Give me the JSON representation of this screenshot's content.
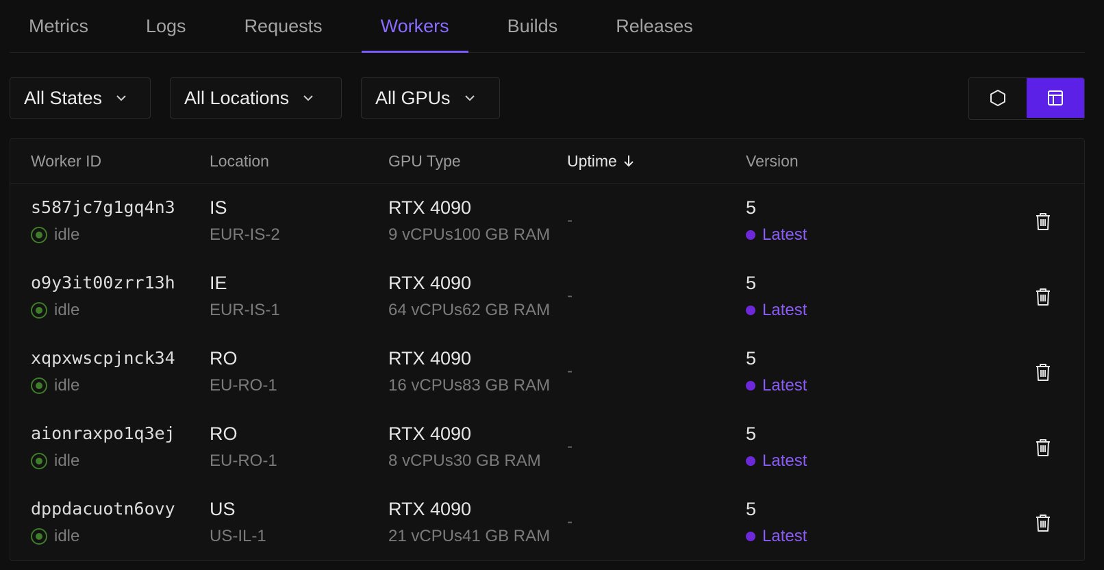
{
  "tabs": [
    {
      "label": "Metrics",
      "active": false
    },
    {
      "label": "Logs",
      "active": false
    },
    {
      "label": "Requests",
      "active": false
    },
    {
      "label": "Workers",
      "active": true
    },
    {
      "label": "Builds",
      "active": false
    },
    {
      "label": "Releases",
      "active": false
    }
  ],
  "filters": {
    "state": "All States",
    "location": "All Locations",
    "gpu": "All GPUs"
  },
  "view_toggle": {
    "grid_icon": "hexagon-icon",
    "table_icon": "table-layout-icon",
    "active": "table"
  },
  "table": {
    "headers": {
      "worker_id": "Worker ID",
      "location": "Location",
      "gpu_type": "GPU Type",
      "uptime": "Uptime",
      "version": "Version"
    },
    "rows": [
      {
        "id": "s587jc7g1gq4n3",
        "status": "idle",
        "loc": "IS",
        "region": "EUR-IS-2",
        "gpu": "RTX 4090",
        "spec": "9 vCPUs100 GB RAM",
        "uptime": "-",
        "version": "5",
        "version_tag": "Latest"
      },
      {
        "id": "o9y3it00zrr13h",
        "status": "idle",
        "loc": "IE",
        "region": "EUR-IS-1",
        "gpu": "RTX 4090",
        "spec": "64 vCPUs62 GB RAM",
        "uptime": "-",
        "version": "5",
        "version_tag": "Latest"
      },
      {
        "id": "xqpxwscpjnck34",
        "status": "idle",
        "loc": "RO",
        "region": "EU-RO-1",
        "gpu": "RTX 4090",
        "spec": "16 vCPUs83 GB RAM",
        "uptime": "-",
        "version": "5",
        "version_tag": "Latest"
      },
      {
        "id": "aionraxpo1q3ej",
        "status": "idle",
        "loc": "RO",
        "region": "EU-RO-1",
        "gpu": "RTX 4090",
        "spec": "8 vCPUs30 GB RAM",
        "uptime": "-",
        "version": "5",
        "version_tag": "Latest"
      },
      {
        "id": "dppdacuotn6ovy",
        "status": "idle",
        "loc": "US",
        "region": "US-IL-1",
        "gpu": "RTX 4090",
        "spec": "21 vCPUs41 GB RAM",
        "uptime": "-",
        "version": "5",
        "version_tag": "Latest"
      }
    ]
  },
  "colors": {
    "accent": "#7c5cff",
    "accent_fill": "#5b21e6",
    "idle_green": "#3f7d2a",
    "latest_purple": "#8b5cf6"
  }
}
